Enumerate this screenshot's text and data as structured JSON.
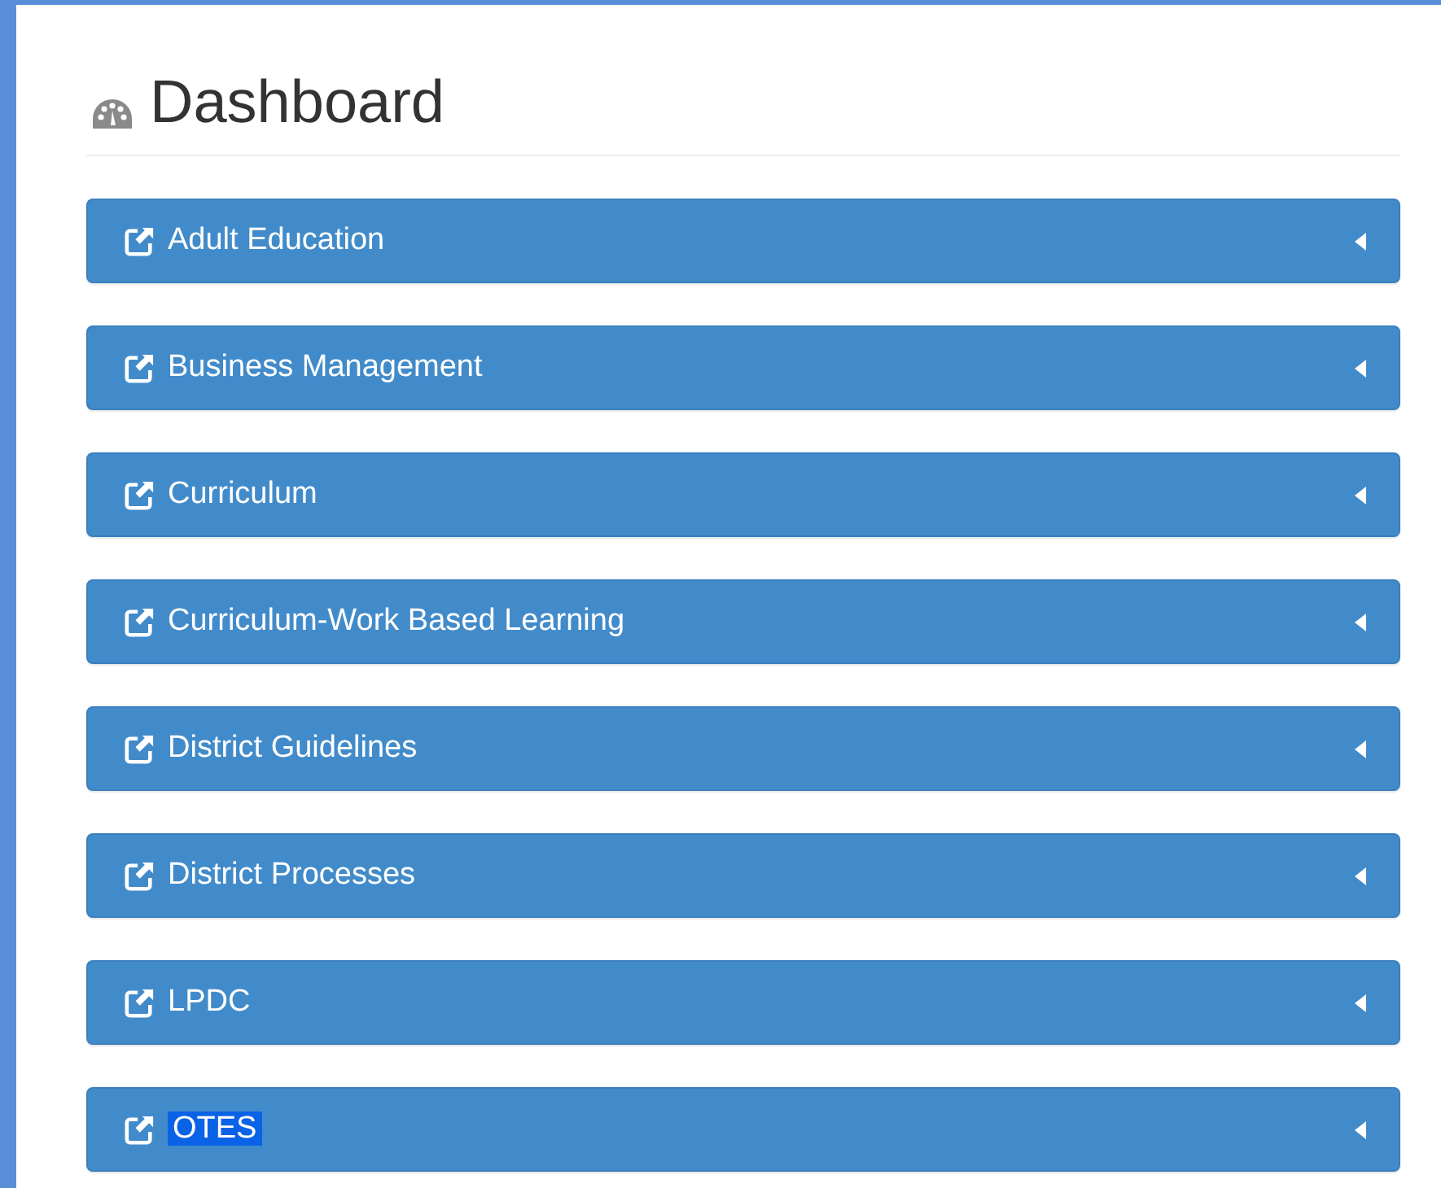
{
  "header": {
    "title": "Dashboard"
  },
  "panels": [
    {
      "label": "Adult Education",
      "highlighted": false
    },
    {
      "label": "Business Management",
      "highlighted": false
    },
    {
      "label": "Curriculum",
      "highlighted": false
    },
    {
      "label": "Curriculum-Work Based Learning",
      "highlighted": false
    },
    {
      "label": "District Guidelines",
      "highlighted": false
    },
    {
      "label": "District Processes",
      "highlighted": false
    },
    {
      "label": "LPDC",
      "highlighted": false
    },
    {
      "label": "OTES",
      "highlighted": true
    }
  ]
}
